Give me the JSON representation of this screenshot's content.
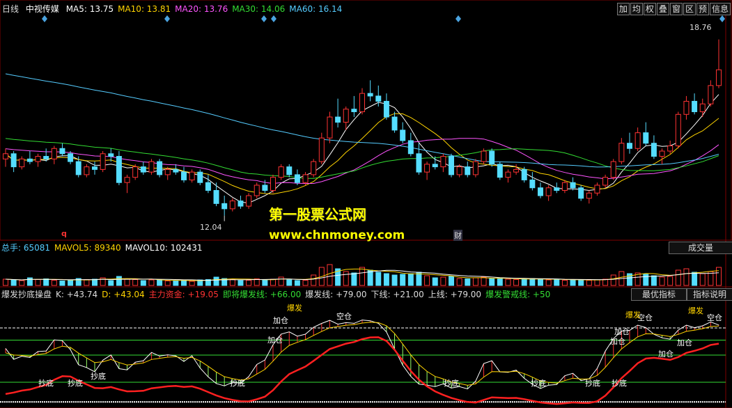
{
  "header": {
    "period": "日线",
    "stock": "中视传媒",
    "ma": [
      {
        "label": "MA5: 13.75",
        "color": "#ffffff"
      },
      {
        "label": "MA10: 13.81",
        "color": "#ffd400"
      },
      {
        "label": "MA20: 13.76",
        "color": "#ff55ff"
      },
      {
        "label": "MA30: 14.06",
        "color": "#33dd33"
      },
      {
        "label": "MA60: 16.14",
        "color": "#55ccff"
      }
    ]
  },
  "toolbar": [
    "加",
    "均",
    "权",
    "叠",
    "窗",
    "区",
    "预",
    "信息"
  ],
  "price_panel": {
    "high_label": "18.76",
    "low_label": "12.04",
    "marker_q": "q",
    "marker_cai": "财"
  },
  "watermark": {
    "line1": "第一股票公式网",
    "line2": "www.chnmoney.com"
  },
  "volume_panel": {
    "items": [
      {
        "label": "总手: 65081",
        "color": "#55ccff"
      },
      {
        "label": "MAVOL5: 89340",
        "color": "#ffd400"
      },
      {
        "label": "MAVOL10: 102431",
        "color": "#ffffff"
      }
    ],
    "button": "成交量"
  },
  "indicator_panel": {
    "items": [
      {
        "label": "爆发抄底操盘",
        "color": "#dddddd"
      },
      {
        "label": "K: +43.74",
        "color": "#dddddd"
      },
      {
        "label": "D: +43.04",
        "color": "#ffd400"
      },
      {
        "label": "主力资金: +19.05",
        "color": "#ff3333"
      },
      {
        "label": "即将爆发线: +66.00",
        "color": "#33dd33"
      },
      {
        "label": "爆发线: +79.00",
        "color": "#dddddd"
      },
      {
        "label": "下线: +21.00",
        "color": "#dddddd"
      },
      {
        "label": "上线: +79.00",
        "color": "#dddddd"
      },
      {
        "label": "爆发警戒线: +50",
        "color": "#33dd33"
      }
    ],
    "button1": "最优指标",
    "button2": "指标说明",
    "annotations": [
      "抄底",
      "抄底",
      "抄底",
      "抄底",
      "抄底",
      "抄底",
      "抄底",
      "抄底",
      "加仓",
      "加仓",
      "加仓",
      "加仓",
      "加仓",
      "加仓",
      "空仓",
      "空仓",
      "空仓",
      "爆发",
      "爆发",
      "爆发"
    ]
  },
  "chart_data": {
    "type": "candlestick",
    "price_range": [
      11.5,
      19.2
    ],
    "candles": [
      [
        14.2,
        14.6,
        13.9,
        14.4
      ],
      [
        14.4,
        14.5,
        13.7,
        13.9
      ],
      [
        13.9,
        14.3,
        13.8,
        14.2
      ],
      [
        14.2,
        14.5,
        14.0,
        14.1
      ],
      [
        14.1,
        14.4,
        13.9,
        14.3
      ],
      [
        14.3,
        14.6,
        14.1,
        14.2
      ],
      [
        14.2,
        14.7,
        14.0,
        14.6
      ],
      [
        14.6,
        14.8,
        14.3,
        14.4
      ],
      [
        14.4,
        14.5,
        14.0,
        14.1
      ],
      [
        14.1,
        14.3,
        13.5,
        13.6
      ],
      [
        13.6,
        14.0,
        13.5,
        13.9
      ],
      [
        13.9,
        14.1,
        13.6,
        13.8
      ],
      [
        13.8,
        14.5,
        13.7,
        14.4
      ],
      [
        14.4,
        14.6,
        14.1,
        14.3
      ],
      [
        14.3,
        14.5,
        13.2,
        13.3
      ],
      [
        13.3,
        13.6,
        12.9,
        13.5
      ],
      [
        13.5,
        14.0,
        13.4,
        13.9
      ],
      [
        13.9,
        14.1,
        13.6,
        13.7
      ],
      [
        13.7,
        14.2,
        13.6,
        14.1
      ],
      [
        14.1,
        14.2,
        13.5,
        13.6
      ],
      [
        13.6,
        13.9,
        13.4,
        13.8
      ],
      [
        13.8,
        14.0,
        13.6,
        13.7
      ],
      [
        13.7,
        13.9,
        13.3,
        13.4
      ],
      [
        13.4,
        13.8,
        13.3,
        13.7
      ],
      [
        13.7,
        13.8,
        13.2,
        13.3
      ],
      [
        13.3,
        13.6,
        12.9,
        13.0
      ],
      [
        13.0,
        13.3,
        12.4,
        12.5
      ],
      [
        12.5,
        12.8,
        12.04,
        12.3
      ],
      [
        12.3,
        12.7,
        12.2,
        12.6
      ],
      [
        12.6,
        12.8,
        12.3,
        12.4
      ],
      [
        12.4,
        12.9,
        12.3,
        12.8
      ],
      [
        12.8,
        13.3,
        12.7,
        13.2
      ],
      [
        13.2,
        13.4,
        12.9,
        13.0
      ],
      [
        13.0,
        13.6,
        12.9,
        13.5
      ],
      [
        13.5,
        14.0,
        13.4,
        13.9
      ],
      [
        13.9,
        14.0,
        13.5,
        13.6
      ],
      [
        13.6,
        13.8,
        13.2,
        13.3
      ],
      [
        13.3,
        13.7,
        13.2,
        13.6
      ],
      [
        13.6,
        14.2,
        13.5,
        14.1
      ],
      [
        14.1,
        15.2,
        14.0,
        15.0
      ],
      [
        15.0,
        16.0,
        14.8,
        15.8
      ],
      [
        15.8,
        16.5,
        15.4,
        15.6
      ],
      [
        15.6,
        16.2,
        15.3,
        16.1
      ],
      [
        16.1,
        16.6,
        15.8,
        16.0
      ],
      [
        16.0,
        16.9,
        15.9,
        16.7
      ],
      [
        16.7,
        17.2,
        16.4,
        16.6
      ],
      [
        16.6,
        17.0,
        16.2,
        16.4
      ],
      [
        16.4,
        16.7,
        15.7,
        15.8
      ],
      [
        15.8,
        16.0,
        15.2,
        15.3
      ],
      [
        15.3,
        15.6,
        14.8,
        14.9
      ],
      [
        14.9,
        15.2,
        14.3,
        14.4
      ],
      [
        14.4,
        14.8,
        13.6,
        13.7
      ],
      [
        13.7,
        14.1,
        13.4,
        14.0
      ],
      [
        14.0,
        14.3,
        13.8,
        13.9
      ],
      [
        13.9,
        14.4,
        13.7,
        14.3
      ],
      [
        14.3,
        14.4,
        13.5,
        13.6
      ],
      [
        13.6,
        14.0,
        13.5,
        13.9
      ],
      [
        13.9,
        14.1,
        13.5,
        13.6
      ],
      [
        13.6,
        14.2,
        13.5,
        14.1
      ],
      [
        14.1,
        14.6,
        14.0,
        14.5
      ],
      [
        14.5,
        14.6,
        13.9,
        14.0
      ],
      [
        14.0,
        14.1,
        13.4,
        13.5
      ],
      [
        13.5,
        13.8,
        13.3,
        13.7
      ],
      [
        13.7,
        14.0,
        13.6,
        13.8
      ],
      [
        13.8,
        13.9,
        13.3,
        13.4
      ],
      [
        13.4,
        13.7,
        13.0,
        13.1
      ],
      [
        13.1,
        13.3,
        12.7,
        12.8
      ],
      [
        12.8,
        13.2,
        12.6,
        13.1
      ],
      [
        13.1,
        13.3,
        12.9,
        13.0
      ],
      [
        13.0,
        13.4,
        12.9,
        13.3
      ],
      [
        13.3,
        13.5,
        13.0,
        13.1
      ],
      [
        13.1,
        13.2,
        12.6,
        12.7
      ],
      [
        12.7,
        13.0,
        12.5,
        12.9
      ],
      [
        12.9,
        13.3,
        12.8,
        13.2
      ],
      [
        13.2,
        13.6,
        13.1,
        13.5
      ],
      [
        13.5,
        14.2,
        13.4,
        14.1
      ],
      [
        14.1,
        15.0,
        14.0,
        14.8
      ],
      [
        14.8,
        15.2,
        14.4,
        14.6
      ],
      [
        14.6,
        15.4,
        14.5,
        15.2
      ],
      [
        15.2,
        15.6,
        14.7,
        14.8
      ],
      [
        14.8,
        15.1,
        14.2,
        14.3
      ],
      [
        14.3,
        14.6,
        14.0,
        14.5
      ],
      [
        14.5,
        14.9,
        14.4,
        14.7
      ],
      [
        14.7,
        16.0,
        14.6,
        15.9
      ],
      [
        15.9,
        16.6,
        15.7,
        16.4
      ],
      [
        16.4,
        16.7,
        15.9,
        16.0
      ],
      [
        16.0,
        16.5,
        15.8,
        16.3
      ],
      [
        16.3,
        17.2,
        16.2,
        17.0
      ],
      [
        17.0,
        18.76,
        16.9,
        17.6
      ]
    ],
    "volume_range": [
      0,
      500000
    ],
    "volume": [
      90000,
      80000,
      70000,
      110000,
      85000,
      95000,
      75000,
      65000,
      70000,
      100000,
      85000,
      90000,
      110000,
      70000,
      130000,
      95000,
      85000,
      70000,
      80000,
      75000,
      65000,
      70000,
      75000,
      60000,
      80000,
      85000,
      120000,
      100000,
      90000,
      70000,
      75000,
      95000,
      80000,
      90000,
      120000,
      80000,
      70000,
      75000,
      150000,
      260000,
      300000,
      240000,
      200000,
      180000,
      260000,
      220000,
      190000,
      170000,
      150000,
      160000,
      170000,
      190000,
      140000,
      110000,
      120000,
      130000,
      100000,
      95000,
      110000,
      120000,
      100000,
      95000,
      90000,
      85000,
      95000,
      100000,
      90000,
      80000,
      85000,
      75000,
      80000,
      85000,
      75000,
      80000,
      90000,
      150000,
      200000,
      170000,
      180000,
      160000,
      140000,
      120000,
      130000,
      220000,
      240000,
      190000,
      170000,
      200000,
      260000
    ],
    "indicator_range": [
      -5,
      108
    ],
    "lines": {
      "即将爆发线": 66,
      "爆发线": 79,
      "下线": 21,
      "上线": 79,
      "爆发警戒线": 50
    }
  }
}
